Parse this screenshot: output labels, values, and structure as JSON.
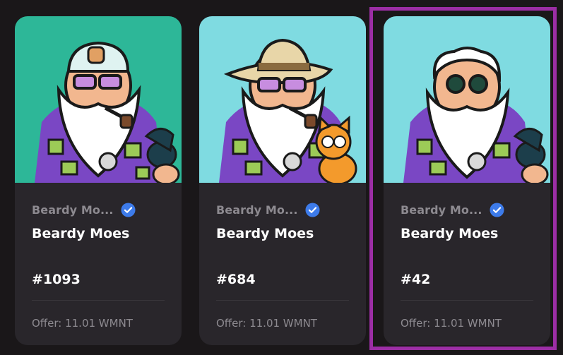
{
  "cards": [
    {
      "collection": "Beardy Mo...",
      "name": "Beardy Moes",
      "token_id": "#1093",
      "offer": "Offer: 11.01 WMNT",
      "bg_color": "#2db798",
      "variant": "helmet-magpie"
    },
    {
      "collection": "Beardy Mo...",
      "name": "Beardy Moes",
      "token_id": "#684",
      "offer": "Offer: 11.01 WMNT",
      "bg_color": "#7fdbe1",
      "variant": "cowboy-cat"
    },
    {
      "collection": "Beardy Mo...",
      "name": "Beardy Moes",
      "token_id": "#42",
      "offer": "Offer: 11.01 WMNT",
      "bg_color": "#7fdbe1",
      "variant": "glasses-magpie"
    }
  ],
  "colors": {
    "page_bg": "#1a1719",
    "card_bg": "#29262b",
    "selection": "#9c2ea5",
    "verified": "#3d7bea"
  },
  "selected_index": 2
}
